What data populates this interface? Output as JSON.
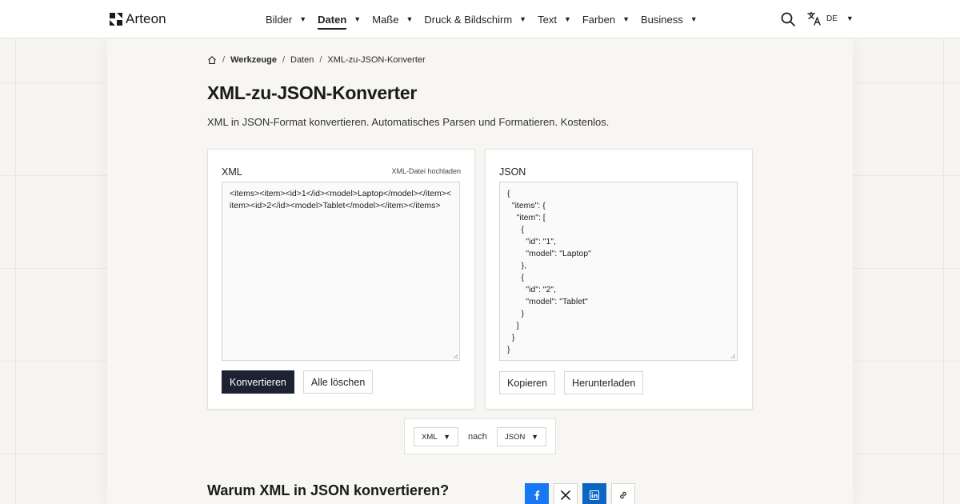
{
  "brand": {
    "name": "Arteon"
  },
  "nav": [
    {
      "label": "Bilder",
      "active": false
    },
    {
      "label": "Daten",
      "active": true
    },
    {
      "label": "Maße",
      "active": false
    },
    {
      "label": "Druck & Bildschirm",
      "active": false
    },
    {
      "label": "Text",
      "active": false
    },
    {
      "label": "Farben",
      "active": false
    },
    {
      "label": "Business",
      "active": false
    }
  ],
  "language": {
    "code": "DE"
  },
  "breadcrumb": {
    "items": [
      "Werkzeuge",
      "Daten",
      "XML-zu-JSON-Konverter"
    ]
  },
  "page": {
    "title": "XML-zu-JSON-Konverter",
    "description": "XML in JSON-Format konvertieren. Automatisches Parsen und Formatieren. Kostenlos."
  },
  "input_panel": {
    "label": "XML",
    "upload_label": "XML-Datei hochladen",
    "value": "<items><item><id>1</id><model>Laptop</model></item><item><id>2</id><model>Tablet</model></item></items>",
    "convert_label": "Konvertieren",
    "clear_label": "Alle löschen"
  },
  "output_panel": {
    "label": "JSON",
    "value": "{\n  \"items\": {\n    \"item\": [\n      {\n        \"id\": \"1\",\n        \"model\": \"Laptop\"\n      },\n      {\n        \"id\": \"2\",\n        \"model\": \"Tablet\"\n      }\n    ]\n  }\n}",
    "copy_label": "Kopieren",
    "download_label": "Herunterladen"
  },
  "format": {
    "from": "XML",
    "connector": "nach",
    "to": "JSON"
  },
  "section": {
    "title": "Warum XML in JSON konvertieren?"
  },
  "share_icons": [
    "facebook-icon",
    "x-icon",
    "linkedin-icon",
    "link-icon"
  ],
  "colors": {
    "primary_button": "#1c2233",
    "facebook": "#1877f2",
    "linkedin": "#0a66c2"
  }
}
